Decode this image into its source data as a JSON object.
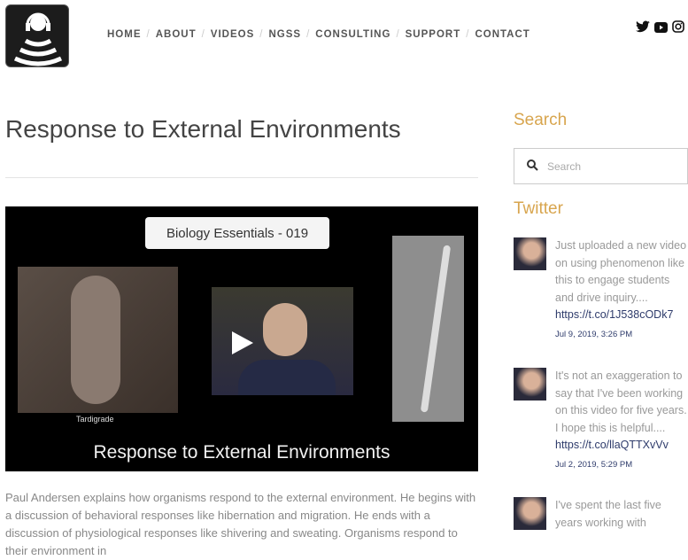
{
  "nav": {
    "items": [
      "HOME",
      "ABOUT",
      "VIDEOS",
      "NGSS",
      "CONSULTING",
      "SUPPORT",
      "CONTACT"
    ]
  },
  "social": [
    "twitter-icon",
    "youtube-icon",
    "instagram-icon"
  ],
  "page": {
    "title": "Response to External Environments",
    "video": {
      "badge": "Biology Essentials - 019",
      "caption": "Tardigrade",
      "title": "Response to External Environments"
    },
    "description": "Paul Andersen explains how organisms respond to the external environment. He begins with a discussion of behavioral responses like hibernation and migration. He ends with a discussion of physiological responses like shivering and sweating. Organisms respond to their environment in"
  },
  "sidebar": {
    "search_heading": "Search",
    "search_placeholder": "Search",
    "twitter_heading": "Twitter",
    "tweets": [
      {
        "text": "Just uploaded a new video on using phenomenon like this to engage students and drive inquiry....",
        "link": "https://t.co/1J538cODk7",
        "date": "Jul 9, 2019, 3:26 PM"
      },
      {
        "text": "It's not an exaggeration to say that I've been working on this video for five years. I hope this is helpful....",
        "link": "https://t.co/llaQTTXvVv",
        "date": "Jul 2, 2019, 5:29 PM"
      },
      {
        "text": "I've spent the last five years working with"
      }
    ]
  }
}
